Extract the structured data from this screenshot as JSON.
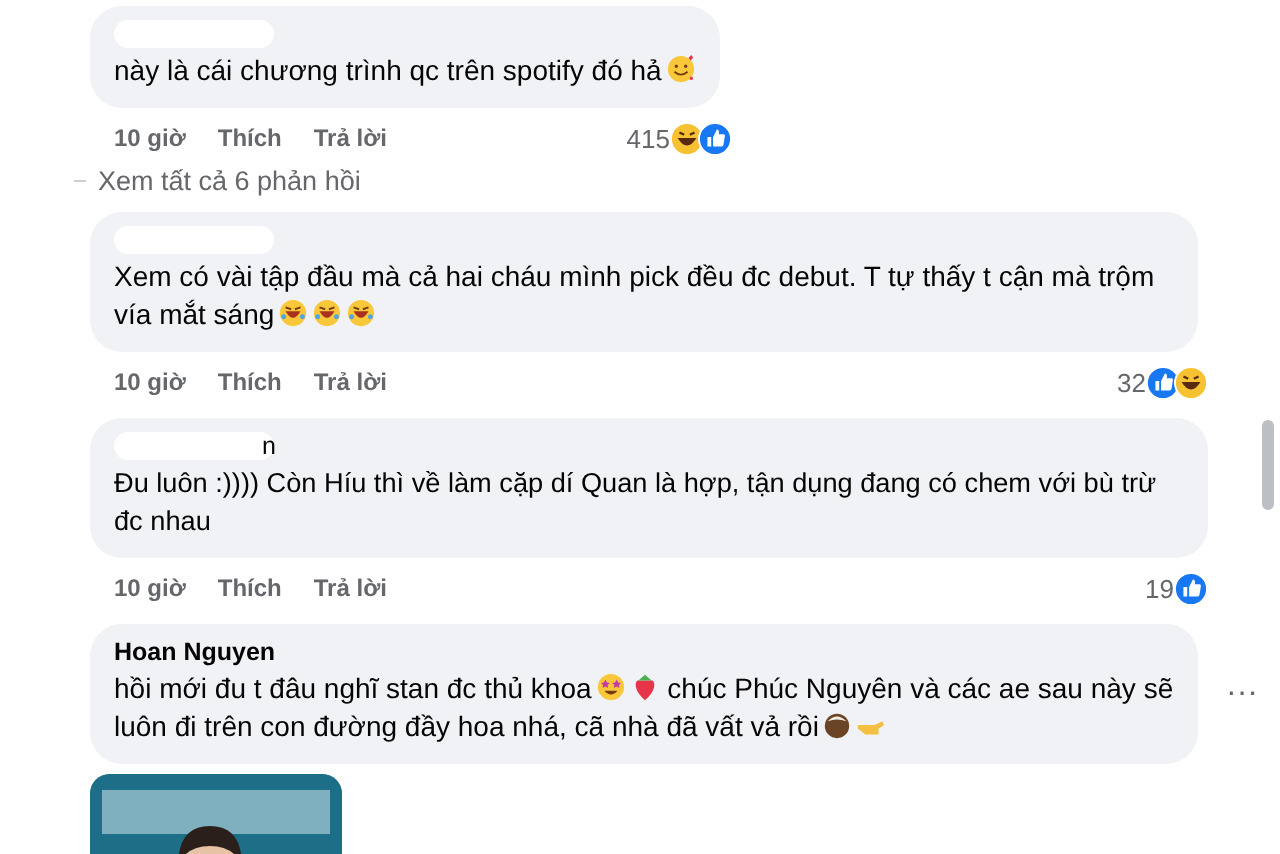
{
  "comments": [
    {
      "redacted": true,
      "segments": [
        {
          "kind": "text",
          "text": "này là cái chương trình qc trên spotify đó hả"
        },
        {
          "kind": "hearts"
        }
      ],
      "time": "10 giờ",
      "like": "Thích",
      "reply": "Trả lời",
      "reaction_count": "415",
      "reactions": [
        {
          "kind": "haha"
        },
        {
          "kind": "like"
        }
      ],
      "view_replies": "Xem tất cả 6 phản hồi"
    },
    {
      "redacted": true,
      "segments": [
        {
          "kind": "text",
          "text": "Xem có vài tập đầu mà cả hai cháu mình pick đều đc debut. T tự thấy t cận mà trộm vía mắt sáng"
        },
        {
          "kind": "rofl"
        },
        {
          "kind": "rofl"
        },
        {
          "kind": "rofl"
        }
      ],
      "time": "10 giờ",
      "like": "Thích",
      "reply": "Trả lời",
      "reaction_count": "32",
      "reactions": [
        {
          "kind": "like"
        },
        {
          "kind": "haha"
        }
      ]
    },
    {
      "author": "n",
      "redacted": true,
      "segments": [
        {
          "kind": "text",
          "text": "Đu luôn :)))) Còn Híu thì về làm cặp dí Quan là hợp, tận dụng đang có chem với bù trừ đc nhau"
        }
      ],
      "time": "10 giờ",
      "like": "Thích",
      "reply": "Trả lời",
      "reaction_count": "19",
      "reactions": [
        {
          "kind": "like"
        }
      ]
    },
    {
      "author": "Hoan Nguyen",
      "segments": [
        {
          "kind": "text",
          "text": "hồi mới đu t đâu nghĩ stan đc thủ khoa"
        },
        {
          "kind": "starstruck"
        },
        {
          "kind": "strawberry"
        },
        {
          "kind": "text",
          "text": " chúc Phúc Nguyên và các ae sau này sẽ luôn đi trên con đường đầy hoa nhá, cã nhà đã vất vả rồi"
        },
        {
          "kind": "coconut"
        },
        {
          "kind": "hand"
        }
      ],
      "more_label": "···"
    }
  ]
}
